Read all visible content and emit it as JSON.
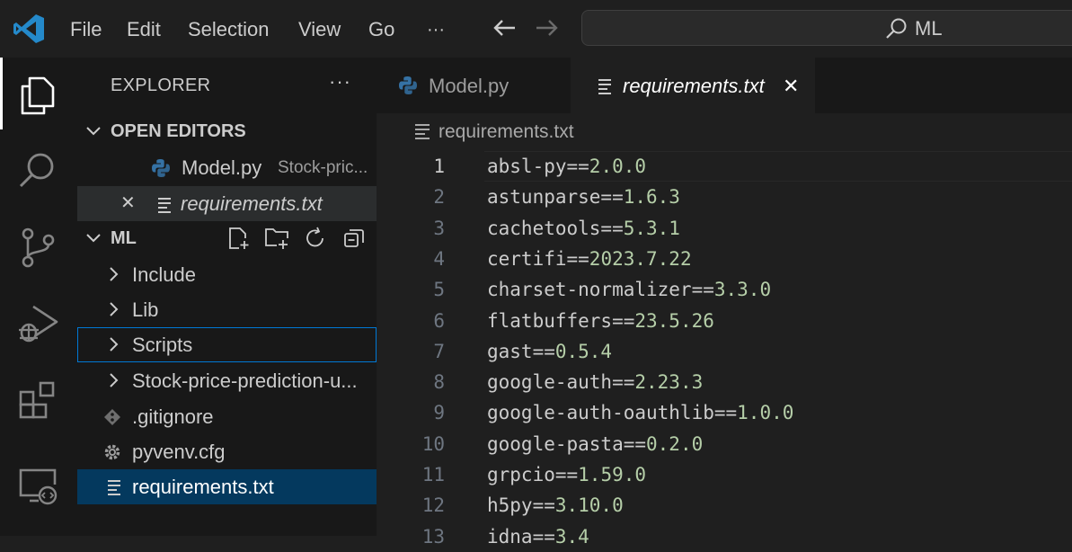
{
  "menu": {
    "file": "File",
    "edit": "Edit",
    "selection": "Selection",
    "view": "View",
    "go": "Go",
    "more": "···"
  },
  "search": {
    "text": "ML"
  },
  "sidebar": {
    "header": "EXPLORER",
    "more": "···",
    "open_editors": {
      "title": "OPEN EDITORS",
      "items": [
        {
          "name": "Model.py",
          "path": "Stock-pric...",
          "icon": "python-icon"
        },
        {
          "name": "requirements.txt",
          "icon": "text-file-icon",
          "close": "✕"
        }
      ]
    },
    "folder": {
      "title": "ML",
      "items": [
        {
          "name": "Include",
          "kind": "folder"
        },
        {
          "name": "Lib",
          "kind": "folder"
        },
        {
          "name": "Scripts",
          "kind": "folder"
        },
        {
          "name": "Stock-price-prediction-u...",
          "kind": "folder"
        },
        {
          "name": ".gitignore",
          "kind": "file",
          "icon": "git-icon"
        },
        {
          "name": "pyvenv.cfg",
          "kind": "file",
          "icon": "gear-icon"
        },
        {
          "name": "requirements.txt",
          "kind": "file",
          "icon": "text-file-icon"
        }
      ]
    }
  },
  "tabs": [
    {
      "label": "Model.py",
      "icon": "python-icon",
      "active": false
    },
    {
      "label": "requirements.txt",
      "icon": "text-file-icon",
      "active": true,
      "close": "✕"
    }
  ],
  "breadcrumb": "requirements.txt",
  "code": [
    {
      "n": "1",
      "pkg": "absl-py==",
      "ver": "2.0.0"
    },
    {
      "n": "2",
      "pkg": "astunparse==",
      "ver": "1.6.3"
    },
    {
      "n": "3",
      "pkg": "cachetools==",
      "ver": "5.3.1"
    },
    {
      "n": "4",
      "pkg": "certifi==",
      "ver": "2023.7.22"
    },
    {
      "n": "5",
      "pkg": "charset-normalizer==",
      "ver": "3.3.0"
    },
    {
      "n": "6",
      "pkg": "flatbuffers==",
      "ver": "23.5.26"
    },
    {
      "n": "7",
      "pkg": "gast==",
      "ver": "0.5.4"
    },
    {
      "n": "8",
      "pkg": "google-auth==",
      "ver": "2.23.3"
    },
    {
      "n": "9",
      "pkg": "google-auth-oauthlib==",
      "ver": "1.0.0"
    },
    {
      "n": "10",
      "pkg": "google-pasta==",
      "ver": "0.2.0"
    },
    {
      "n": "11",
      "pkg": "grpcio==",
      "ver": "1.59.0"
    },
    {
      "n": "12",
      "pkg": "h5py==",
      "ver": "3.10.0"
    },
    {
      "n": "13",
      "pkg": "idna==",
      "ver": "3.4"
    }
  ],
  "colors": {
    "accent": "#0078d4",
    "selection": "#04395e",
    "version": "#b5cea8",
    "python_blue": "#3572a5",
    "vscode_blue": "#2489ca"
  }
}
